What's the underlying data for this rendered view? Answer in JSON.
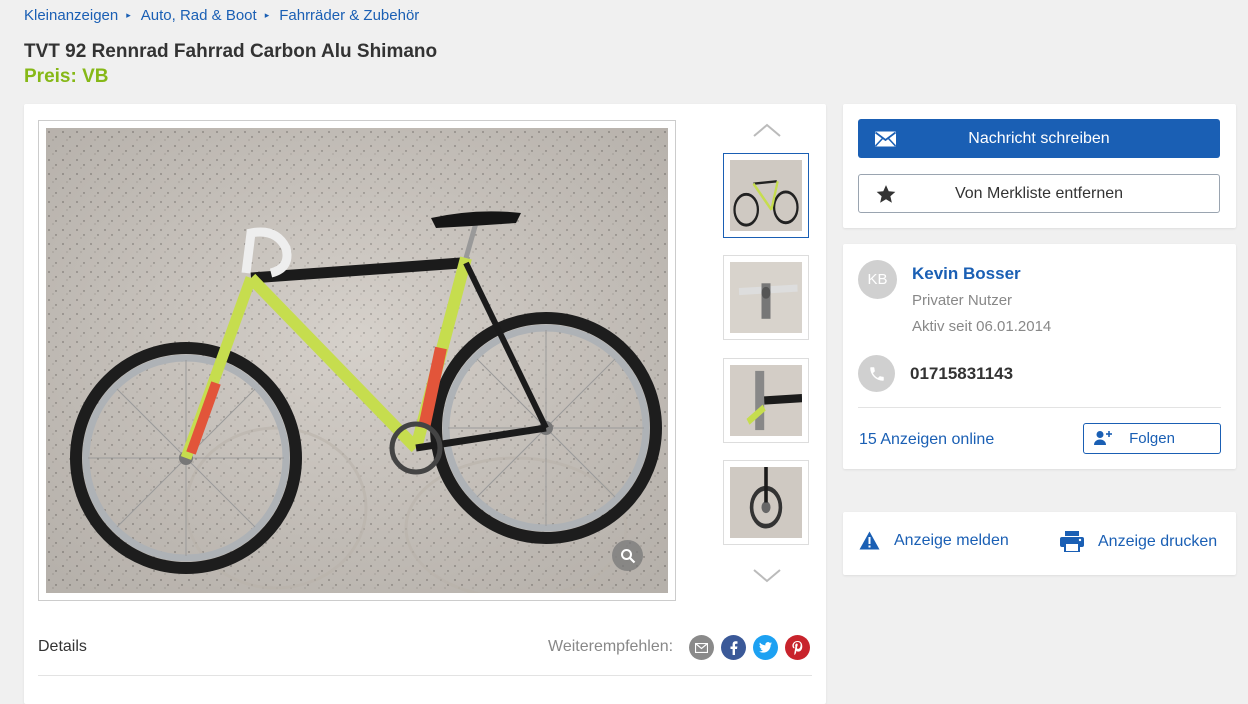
{
  "breadcrumb": {
    "items": [
      "Kleinanzeigen",
      "Auto, Rad & Boot",
      "Fahrräder & Zubehör"
    ],
    "separator": "▸"
  },
  "listing": {
    "title": "TVT 92 Rennrad Fahrrad Carbon Alu Shimano",
    "price": "Preis: VB"
  },
  "gallery": {
    "thumbnail_count": 4,
    "active_thumbnail": 1
  },
  "details": {
    "label": "Details",
    "share_label": "Weiterempfehlen:",
    "share_icons": [
      "email-icon",
      "facebook-icon",
      "twitter-icon",
      "pinterest-icon"
    ]
  },
  "actions": {
    "message_button": "Nachricht schreiben",
    "watchlist_button": "Von Merkliste entfernen"
  },
  "seller": {
    "initials": "KB",
    "name": "Kevin Bosser",
    "type": "Privater Nutzer",
    "active_since": "Aktiv seit 06.01.2014",
    "phone": "01715831143",
    "ads_online": "15 Anzeigen online",
    "follow_button": "Folgen"
  },
  "report": {
    "report_link": "Anzeige melden",
    "print_link": "Anzeige drucken"
  },
  "colors": {
    "brand_blue": "#1a5fb4",
    "price_green": "#86b817",
    "background": "#f0f0f0"
  }
}
